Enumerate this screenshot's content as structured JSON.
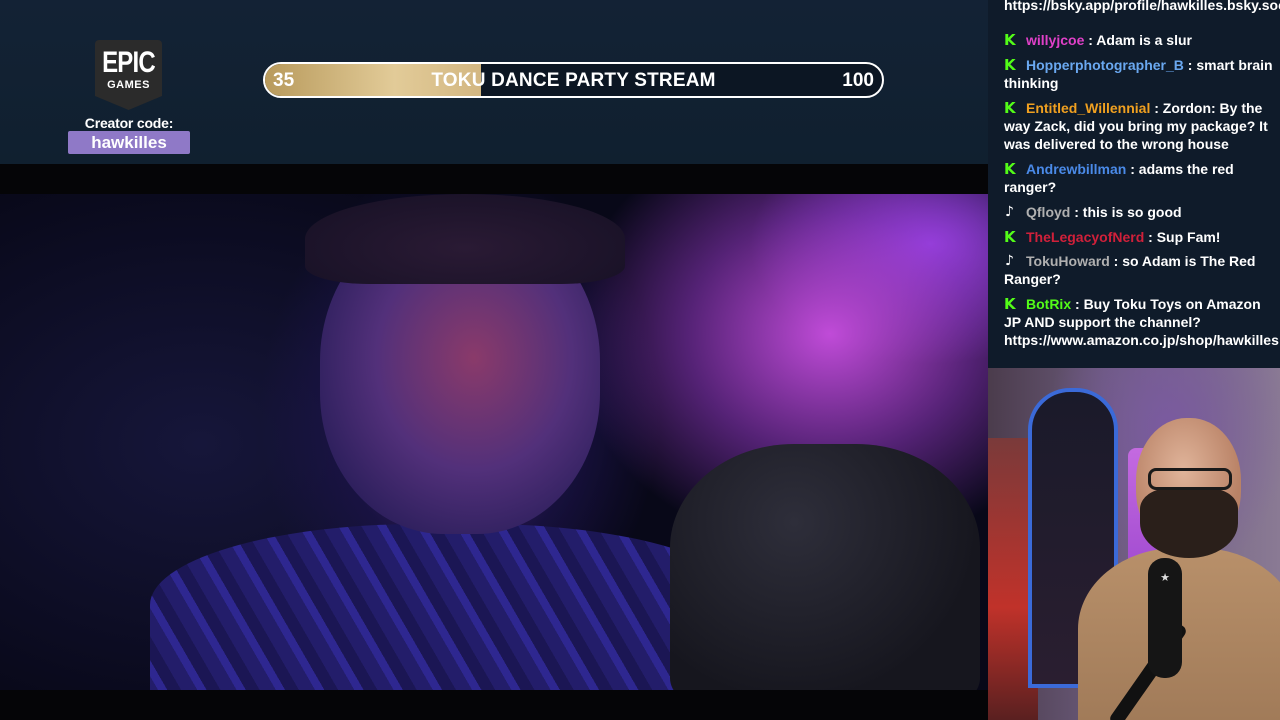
{
  "overlay": {
    "epic_logo": {
      "line1": "EPIC",
      "line2": "GAMES"
    },
    "creator_label": "Creator code:",
    "creator_code": "hawkilles",
    "goal": {
      "title": "TOKU DANCE PARTY STREAM",
      "current": "35",
      "target": "100",
      "progress_fraction": 0.35,
      "fill_color": "#d9c28f"
    }
  },
  "chat": {
    "messages": [
      {
        "platform": "kick",
        "user": "",
        "user_color": "#ffffff",
        "text": "https://bsky.app/profile/hawkilles.bsky.social",
        "partial": true
      },
      {
        "platform": "kick",
        "user": "willyjcoe",
        "user_color": "#e040c8",
        "text": ": Adam is a slur"
      },
      {
        "platform": "kick",
        "user": "Hopperphotographer_B",
        "user_color": "#6aa8f0",
        "text": ": smart brain thinking"
      },
      {
        "platform": "kick",
        "user": "Entitled_Willennial",
        "user_color": "#f0a020",
        "text": ": Zordon: By the way Zack, did you bring my package? It was delivered to the wrong house"
      },
      {
        "platform": "kick",
        "user": "Andrewbillman",
        "user_color": "#4a8ae8",
        "text": ": adams the red ranger?"
      },
      {
        "platform": "tiktok",
        "user": "Qfloyd",
        "user_color": "#b0b0b0",
        "text": ": this is so good"
      },
      {
        "platform": "kick",
        "user": "TheLegacyofNerd",
        "user_color": "#d0203a",
        "text": ": Sup Fam!"
      },
      {
        "platform": "tiktok",
        "user": "TokuHoward",
        "user_color": "#b0b0b0",
        "text": ": so Adam is The Red Ranger?"
      },
      {
        "platform": "kick",
        "user": "BotRix",
        "user_color": "#53fc18",
        "text": ": Buy Toku Toys on Amazon JP AND support the channel? https://www.amazon.co.jp/shop/hawkilles"
      }
    ]
  },
  "colors": {
    "kick_green": "#53fc18",
    "background": "#0f1b2a",
    "creator_code_bg": "#8f79c7"
  }
}
